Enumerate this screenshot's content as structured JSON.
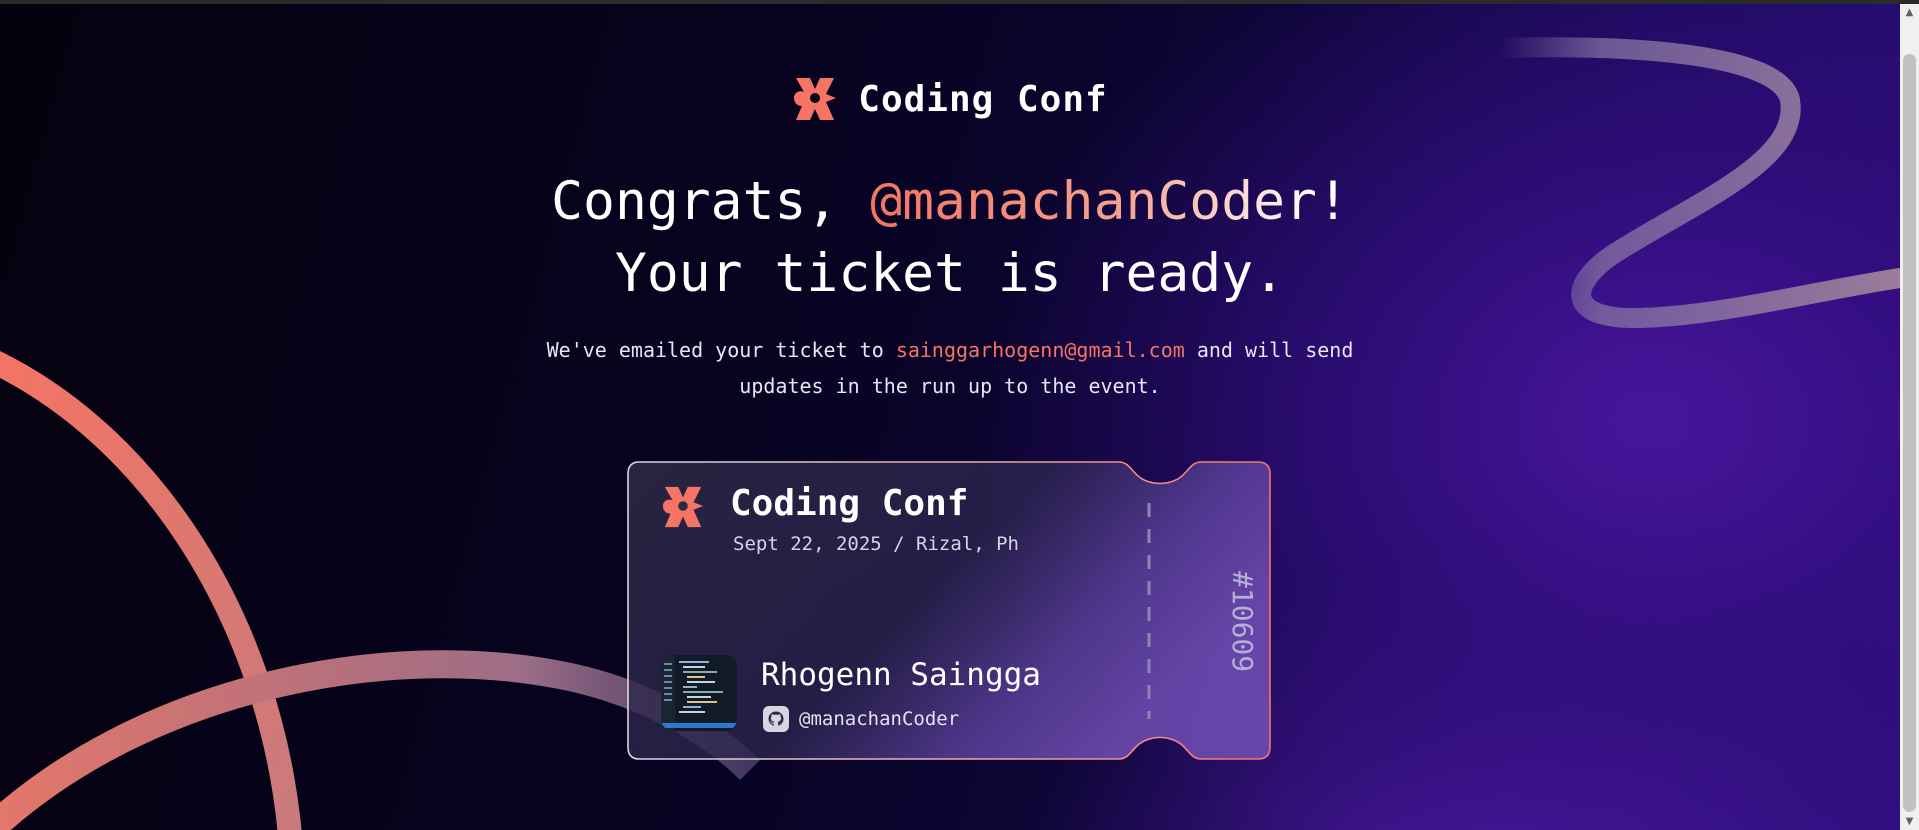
{
  "brand": {
    "name": "Coding Conf"
  },
  "headline": {
    "prefix": "Congrats, ",
    "handle": "@manachanCoder",
    "suffix": "!",
    "line2": "Your ticket is ready."
  },
  "subline": {
    "before": "We've emailed your ticket to ",
    "email": "sainggarhogenn@gmail.com",
    "after": " and will send",
    "line2": "updates in the run up to the event."
  },
  "ticket": {
    "title": "Coding Conf",
    "meta": "Sept 22, 2025 / Rizal, Ph",
    "attendee_name": "Rhogenn Saingga",
    "github_handle": "@manachanCoder",
    "number": "#10609"
  },
  "colors": {
    "accent": "#f57463",
    "background": "#070318",
    "purple": "#4a16a0"
  },
  "icons": {
    "logo": "coding-conf-logo-icon",
    "github": "github-icon",
    "scroll_up": "chevron-up-icon",
    "scroll_down": "chevron-down-icon"
  }
}
